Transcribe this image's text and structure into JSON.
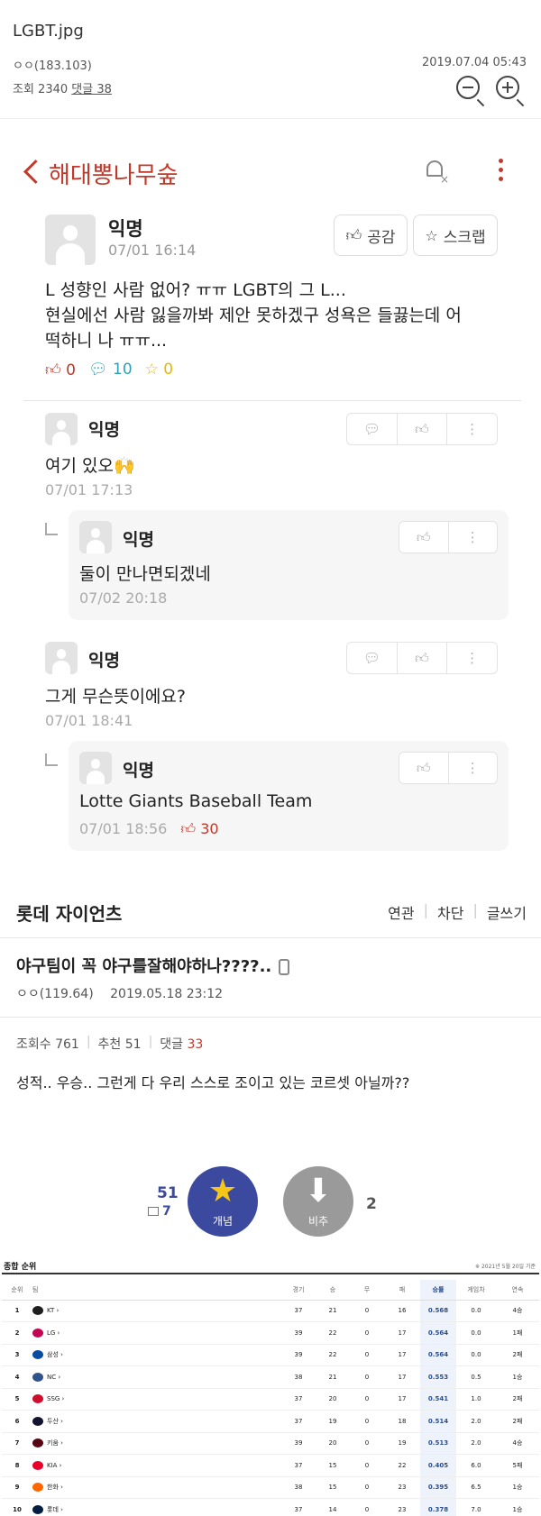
{
  "header": {
    "filename": "LGBT.jpg",
    "author": "ㅇㅇ(183.103)",
    "views_label": "조회 2340",
    "comments_label": "댓글 38",
    "date": "2019.07.04 05:43"
  },
  "app": {
    "board_title": "해대뽕나무숲",
    "post": {
      "author": "익명",
      "time": "07/01 16:14",
      "like_button": "공감",
      "scrap_button": "스크랩",
      "lines": [
        "L 성향인 사람 없어? ㅠㅠ LGBT의 그 L...",
        "현실에선 사람 잃을까봐 제안 못하겠구 성욕은 들끓는데 어",
        "떡하니 나 ㅠㅠ..."
      ],
      "like_count": "0",
      "comment_count": "10",
      "scrap_count": "0"
    },
    "comments": [
      {
        "author": "익명",
        "text": "여기 있오🙌",
        "time": "07/01 17:13"
      },
      {
        "author": "익명",
        "text": "둘이 만나면되겠네",
        "time": "07/02 20:18"
      },
      {
        "author": "익명",
        "text": "그게 무슨뜻이에요?",
        "time": "07/01 18:41"
      },
      {
        "author": "익명",
        "text": "Lotte Giants Baseball Team",
        "time": "07/01 18:56",
        "likes": "30"
      }
    ]
  },
  "board": {
    "title": "롯데 자이언츠",
    "menu": [
      "연관",
      "차단",
      "글쓰기"
    ],
    "post_title": "야구팀이 꼭 야구를잘해야하나????..",
    "author": "ㅇㅇ(119.64)",
    "date": "2019.05.18 23:12",
    "views": "조회수 761",
    "recommend": "추천 51",
    "comments_label": "댓글",
    "comments_count": "33",
    "content": "성적.. 우승.. 그런게 다 우리 스스로 조이고 있는 코르셋 아닐까??",
    "upvote_label": "개념",
    "downvote_label": "비추",
    "up_count": "51",
    "up_sub": "7",
    "down_count": "2"
  },
  "standings": {
    "title": "종합 순위",
    "note": "※ 2021년 5월 20일 기준",
    "columns": [
      "순위",
      "팀",
      "경기",
      "승",
      "무",
      "패",
      "승률",
      "게임차",
      "연속"
    ],
    "rows": [
      [
        "1",
        "KT",
        "37",
        "21",
        "0",
        "16",
        "0.568",
        "0.0",
        "4승"
      ],
      [
        "2",
        "LG",
        "39",
        "22",
        "0",
        "17",
        "0.564",
        "0.0",
        "1패"
      ],
      [
        "3",
        "삼성",
        "39",
        "22",
        "0",
        "17",
        "0.564",
        "0.0",
        "2패"
      ],
      [
        "4",
        "NC",
        "38",
        "21",
        "0",
        "17",
        "0.553",
        "0.5",
        "1승"
      ],
      [
        "5",
        "SSG",
        "37",
        "20",
        "0",
        "17",
        "0.541",
        "1.0",
        "2패"
      ],
      [
        "6",
        "두산",
        "37",
        "19",
        "0",
        "18",
        "0.514",
        "2.0",
        "2패"
      ],
      [
        "7",
        "키움",
        "39",
        "20",
        "0",
        "19",
        "0.513",
        "2.0",
        "4승"
      ],
      [
        "8",
        "KIA",
        "37",
        "15",
        "0",
        "22",
        "0.405",
        "6.0",
        "5패"
      ],
      [
        "9",
        "한화",
        "38",
        "15",
        "0",
        "23",
        "0.395",
        "6.5",
        "1승"
      ],
      [
        "10",
        "롯데",
        "37",
        "14",
        "0",
        "23",
        "0.378",
        "7.0",
        "1승"
      ]
    ],
    "logo_colors": [
      "#1f1f1f",
      "#c30452",
      "#074ca1",
      "#315288",
      "#ce0e2d",
      "#131230",
      "#570514",
      "#ea0029",
      "#ff6600",
      "#041e42"
    ]
  },
  "colors": {
    "accent_red": "#c0392b",
    "teal": "#2aa3b9",
    "vote_blue": "#3b4a9e"
  }
}
